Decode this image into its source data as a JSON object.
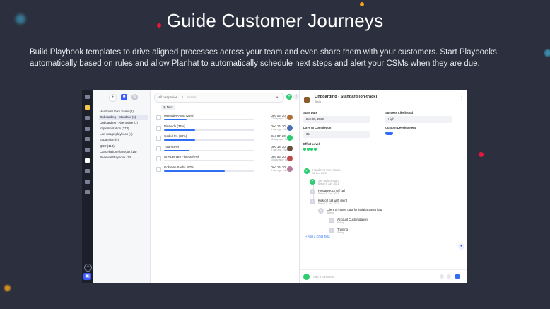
{
  "heading": "Guide Customer Journeys",
  "description": "Build Playbook templates to drive aligned processes across your team and even share them with your customers. Start Playbooks automatically based on rules and allow Planhat to automatically schedule next steps and alert your CSMs when they are due.",
  "colors": {
    "background": "#2c2f3d",
    "accent": "#2f6ff5",
    "success": "#2ecc71",
    "dot_red": "#e8173c",
    "dot_orange": "#f2a21b",
    "dot_teal": "#3fb3d8"
  },
  "app": {
    "rail_icons": [
      "search-icon",
      "dashboard-icon",
      "inbox-icon",
      "calendar-icon",
      "tasks-icon",
      "chart-icon",
      "playbooks-icon",
      "megaphone-icon",
      "users-icon",
      "settings-icon"
    ],
    "rail_add": "+",
    "playbooks_sidebar": {
      "items": [
        "Handover from Sales (2)",
        "Onboarding - Standard (6)",
        "Onboarding - Alternative (1)",
        "Implementation (273)",
        "Low usage playbook (4)",
        "Expansion (4)",
        "QBR (113)",
        "Cancellation Playbook (16)",
        "Renewal Playbook (13)"
      ],
      "active_index": 1
    },
    "search": {
      "scope": "All companies",
      "placeholder": "Search...",
      "add": "+",
      "more": "⋮"
    },
    "filter": "⊕ New",
    "companies": [
      {
        "name": "Mercedes-AMG (25%)",
        "progress": 25,
        "date": "Dec 06, 20",
        "sub": "12 day ago · Noone",
        "avatar": "#b0703a"
      },
      {
        "name": "Nintendo (34%)",
        "progress": 34,
        "date": "Dec 16, 20",
        "sub": "9 day ago · Noone",
        "avatar": "#4a6fb5"
      },
      {
        "name": "Coded P.I. (34%)",
        "progress": 34,
        "date": "Dec 07, 20",
        "sub": "12 day ago · Noone",
        "avatar": "#2ecc71"
      },
      {
        "name": "Tufa (28%)",
        "progress": 28,
        "date": "Dec 18, 20",
        "sub": "5 day ago · Noone",
        "avatar": "#6b4f3a"
      },
      {
        "name": "Greypetharp Fitness (0%)",
        "progress": 0,
        "date": "Dec 06, 20",
        "sub": "10 day ago · Noone",
        "avatar": "#c04a4a"
      },
      {
        "name": "Goldman Sachs (67%)",
        "progress": 67,
        "date": "Dec 16, 20",
        "sub": "9 day ago · Noone",
        "avatar": "#b57a9b"
      }
    ],
    "detail": {
      "title": "Onboarding - Standard (on-track)",
      "subtitle": "Tesla",
      "start_date_label": "Start Date",
      "start_date": "Dec 08, 2020",
      "success_label": "Success Likelihood",
      "success": "High",
      "days_label": "Days to Completion",
      "days": "35",
      "custom_label": "Custom Development",
      "effort_label": "Effort Level",
      "effort_level": 4,
      "timeline": [
        {
          "title": "Handover from Sales",
          "sub": "12 Dec 2020",
          "state": "done"
        },
        {
          "title": "Set up kickstart",
          "sub": "Shiroy 5 Jun, 2021",
          "state": "done"
        },
        {
          "title": "Prepare Kick Off call",
          "sub": "Shiroy 5 Jun, 2021",
          "state": "todo"
        },
        {
          "title": "Kick-off call with client",
          "sub": "Shiroy 5 Jun, 2021",
          "state": "todo"
        },
        {
          "title": "Client to import data for initial account load",
          "sub": "Shiroy",
          "state": "todo"
        },
        {
          "title": "Account Customization",
          "sub": "Shiroy",
          "state": "todo"
        },
        {
          "title": "Training",
          "sub": "Shiroy",
          "state": "todo"
        }
      ],
      "add_child": "+ Add a Child Task",
      "comment_placeholder": "Add a comment"
    }
  }
}
